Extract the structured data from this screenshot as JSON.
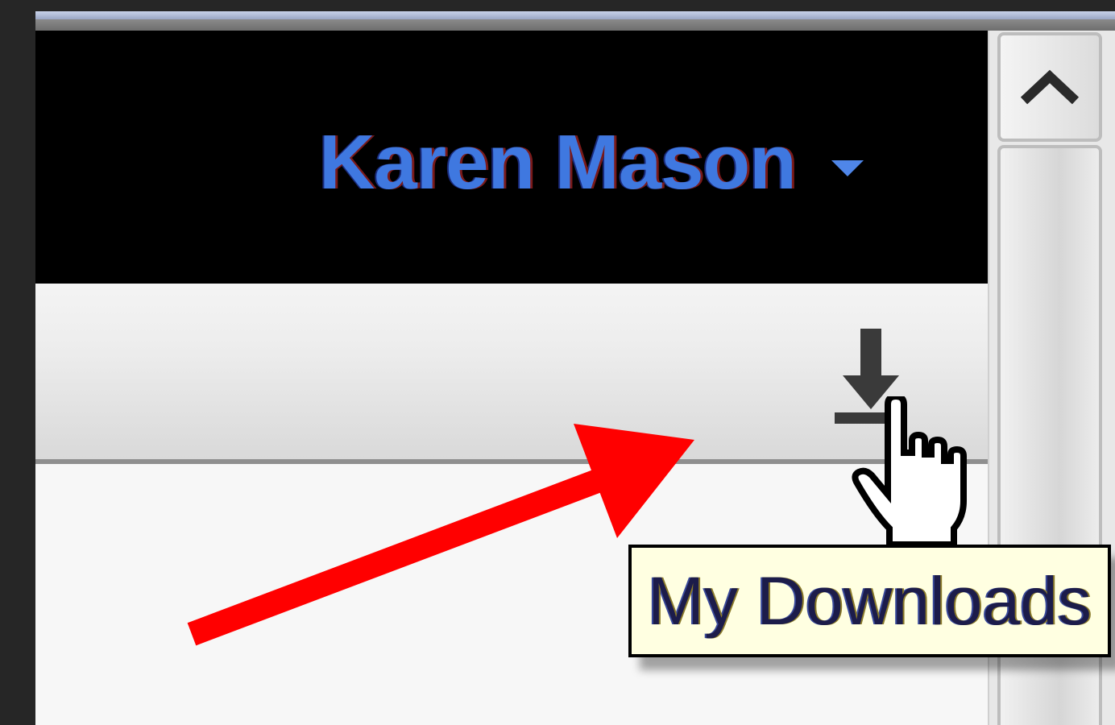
{
  "header": {
    "user_name": "Karen Mason"
  },
  "toolbar": {
    "download_icon": "download-icon"
  },
  "tooltip": {
    "text": "My Downloads"
  },
  "scrollbar": {
    "up_icon": "chevron-up-icon"
  },
  "colors": {
    "header_bg": "#000000",
    "user_name": "#3f78e0",
    "tooltip_bg": "#ffffe1",
    "annotation_arrow": "#ff0000"
  }
}
